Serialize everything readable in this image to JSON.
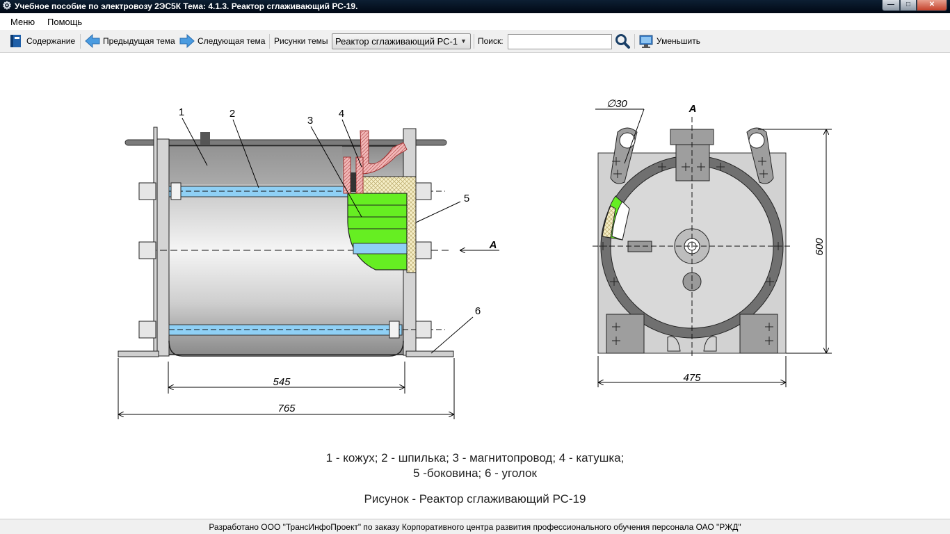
{
  "window": {
    "title": "Учебное пособие по электровозу 2ЭС5К Тема: 4.1.3. Реактор сглаживающий РС-19.",
    "min_glyph": "—",
    "max_glyph": "□",
    "close_glyph": "✕"
  },
  "menu": {
    "items": [
      "Меню",
      "Помощь"
    ]
  },
  "toolbar": {
    "contents_label": "Содержание",
    "prev_label": "Предыдущая тема",
    "next_label": "Следующая тема",
    "figures_label": "Рисунки темы",
    "figure_selected": "Реактор сглаживающий РС-1",
    "search_label": "Поиск:",
    "search_value": "",
    "shrink_label": "Уменьшить"
  },
  "figure": {
    "callouts": [
      "1",
      "2",
      "3",
      "4",
      "5",
      "6"
    ],
    "arrow_label": "А",
    "view_label": "А",
    "dim_545": "545",
    "dim_765": "765",
    "dim_475": "475",
    "dim_600": "600",
    "dim_d30": "∅30",
    "legend_line1": "1 - кожух; 2 - шпилька; 3 - магнитопровод; 4 - катушка;",
    "legend_line2": "5 -боковина; 6 - уголок",
    "caption": "Рисунок - Реактор сглаживающий РС-19"
  },
  "footer": {
    "text": "Разработано ООО \"ТрансИнфоПроект\" по заказу Корпоративного центра развития профессионального обучения персонала ОАО \"РЖД\""
  },
  "colors": {
    "coil_pink": "#f2b8b8",
    "core_green": "#66ee22",
    "stud_blue": "#8fd0f5",
    "frame_gray": "#d2d2d2",
    "ring_dark": "#707070"
  }
}
